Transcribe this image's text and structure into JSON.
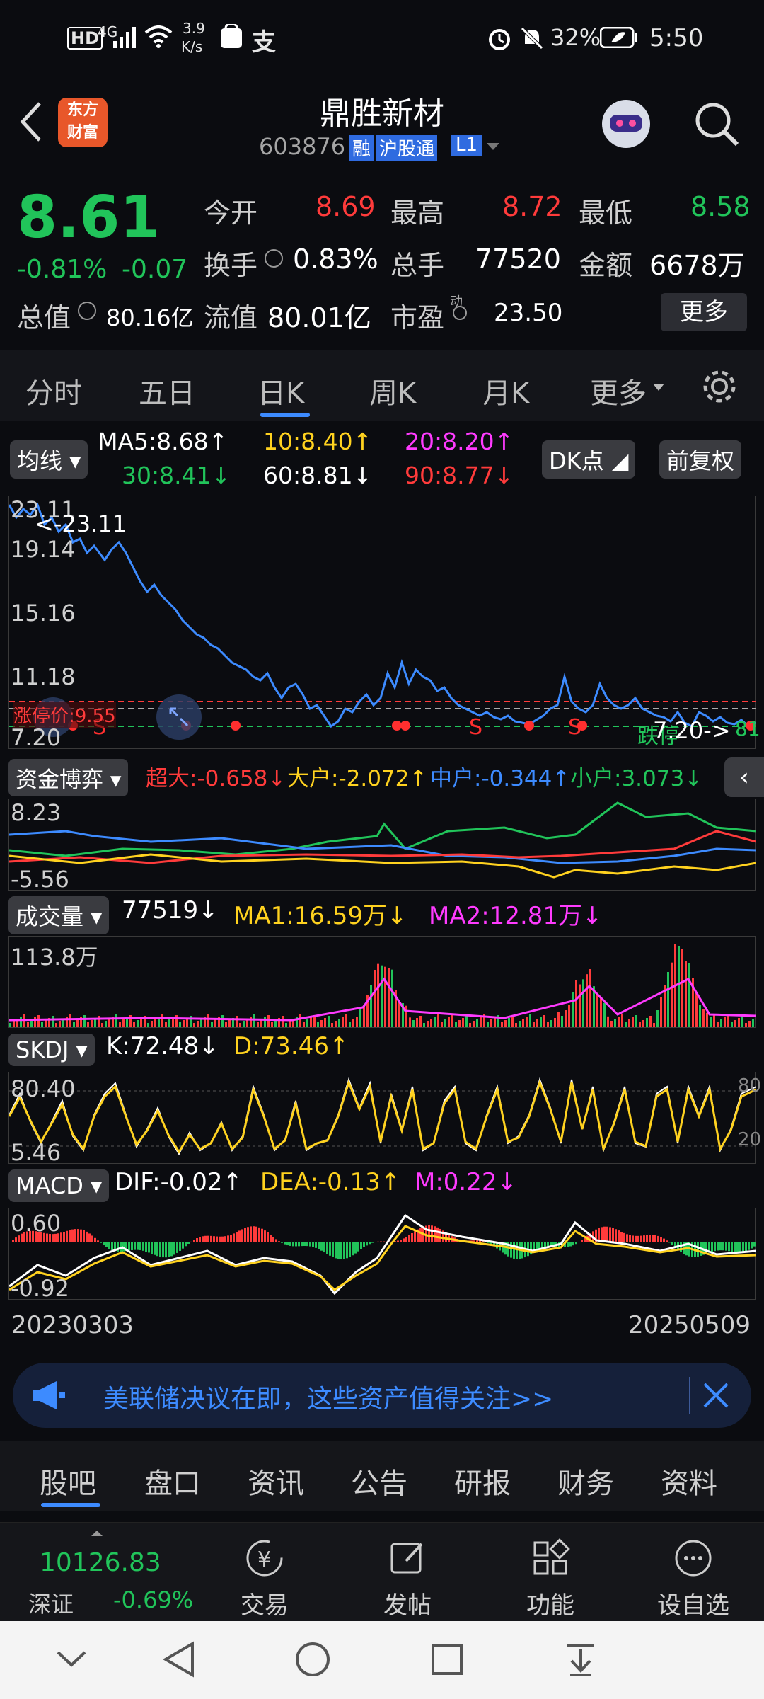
{
  "status": {
    "net_badge": "HD",
    "signal": "4G",
    "speed_top": "3.9",
    "speed_bottom": "K/s",
    "battery": "32%",
    "time": "5:50"
  },
  "header": {
    "title": "鼎胜新材",
    "code": "603876",
    "tag_rong": "融",
    "tag_hgt": "沪股通",
    "tag_l1": "L1",
    "logo_top": "东方",
    "logo_bottom": "财富"
  },
  "quote": {
    "price": "8.61",
    "change_pct": "-0.81%",
    "change": "-0.07",
    "open_label": "今开",
    "open": "8.69",
    "high_label": "最高",
    "high": "8.72",
    "low_label": "最低",
    "low": "8.58",
    "turnover_label": "换手",
    "turnover": "0.83%",
    "volume_label": "总手",
    "volume": "77520",
    "amount_label": "金额",
    "amount": "6678万",
    "mktcap_label": "总值",
    "mktcap": "80.16亿",
    "float_label": "流值",
    "float": "80.01亿",
    "pe_label": "市盈",
    "pe_sup": "动",
    "pe": "23.50",
    "more": "更多"
  },
  "ktabs": [
    "分时",
    "五日",
    "日K",
    "周K",
    "月K",
    "更多"
  ],
  "ktab_active": "日K",
  "ma": {
    "chip": "均线",
    "ma5": "MA5:8.68",
    "ma10": "10:8.40",
    "ma20": "20:8.20",
    "ma30": "30:8.41",
    "ma60": "60:8.81",
    "ma90": "90:8.77",
    "dk": "DK点",
    "fq": "前复权"
  },
  "kpanel": {
    "top_price": "23.11",
    "max_label": "<-23.11",
    "y2": "19.14",
    "y3": "15.16",
    "y4": "11.18",
    "limit_up": "涨停价:9.55",
    "y5": "7.20",
    "limit_down": "跌停",
    "min_label": "7.20->",
    "right_frag": "81"
  },
  "fund": {
    "chip": "资金博弈",
    "super": "超大:-0.658",
    "big": "大户:-2.072",
    "mid": "中户:-0.344",
    "small": "小户:3.073",
    "y_top": "8.23",
    "y_bot": "-5.56"
  },
  "vol": {
    "chip": "成交量",
    "value": "77519",
    "ma1": "MA1:16.59万",
    "ma2": "MA2:12.81万",
    "y_top": "113.8万"
  },
  "skdj": {
    "chip": "SKDJ",
    "k": "K:72.48",
    "d": "D:73.46",
    "y_top": "80.40",
    "y_bot": "5.46",
    "r_top": "80",
    "r_bot": "20"
  },
  "macd": {
    "chip": "MACD",
    "dif": "DIF:-0.02",
    "dea": "DEA:-0.13",
    "m": "M:0.22",
    "y_top": "0.60",
    "y_bot": "-0.92"
  },
  "dates": {
    "start": "20230303",
    "end": "20250509"
  },
  "banner": {
    "text": "美联储决议在即，这些资产值得关注>>"
  },
  "btabs": [
    "股吧",
    "盘口",
    "资讯",
    "公告",
    "研报",
    "财务",
    "资料"
  ],
  "btab_active": "股吧",
  "footer": {
    "index_value": "10126.83",
    "index_name": "深证",
    "index_change": "-0.69%",
    "trade": "交易",
    "post": "发帖",
    "func": "功能",
    "watch": "设自选"
  },
  "colors": {
    "up": "#ff3b3b",
    "down": "#21c45a",
    "accent": "#3d8bff",
    "ma10": "#ffd21f",
    "ma20": "#ff3bff"
  }
}
